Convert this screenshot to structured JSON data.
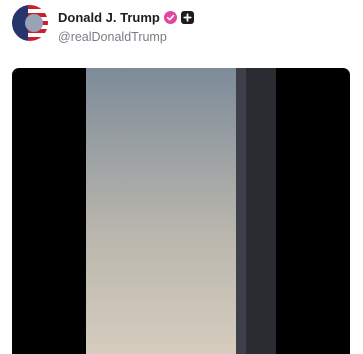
{
  "post": {
    "author": {
      "display_name": "Donald J. Trump",
      "handle": "@realDonaldTrump",
      "verified_badge_icon": "verified-badge-icon",
      "affiliation_badge_icon": "plus-badge-icon",
      "avatar_icon": "avatar-image"
    },
    "media": {
      "type": "video",
      "placeholder_icon": "video-image-placeholder"
    }
  },
  "colors": {
    "verified_badge": "#e0479e",
    "affiliation_badge": "#1d1d1f",
    "name_text": "#1d1d1f",
    "handle_text": "#7b7d85",
    "media_letterbox": "#000000",
    "avatar_red": "#c8202f",
    "avatar_blue": "#26356b"
  }
}
